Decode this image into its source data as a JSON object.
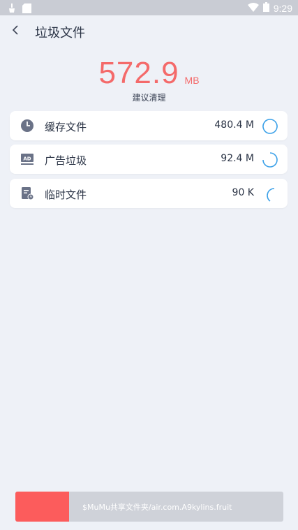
{
  "status_bar": {
    "time": "9:29",
    "icons": [
      "cleaner-notification-icon",
      "sd-card-icon",
      "wifi-icon",
      "battery-icon"
    ]
  },
  "header": {
    "title": "垃圾文件",
    "back_icon": "chevron-left-icon"
  },
  "summary": {
    "size_value": "572.9",
    "size_unit": "MB",
    "suggestion": "建议清理"
  },
  "items": [
    {
      "label": "缓存文件",
      "value": "480.4 M",
      "icon": "clock-icon",
      "progress": 1.0
    },
    {
      "label": "广告垃圾",
      "value": "92.4 M",
      "icon": "ad-icon",
      "progress": 0.75
    },
    {
      "label": "临时文件",
      "value": "90 K",
      "icon": "temp-file-icon",
      "progress": 0.3
    }
  ],
  "bottom_bar": {
    "text": "$MuMu共享文件夹/air.com.A9kylins.fruit",
    "progress": 0.2
  },
  "colors": {
    "accent_red": "#f46a6a",
    "spinner_blue": "#3aa0e8",
    "icon_gray": "#6a7287"
  }
}
